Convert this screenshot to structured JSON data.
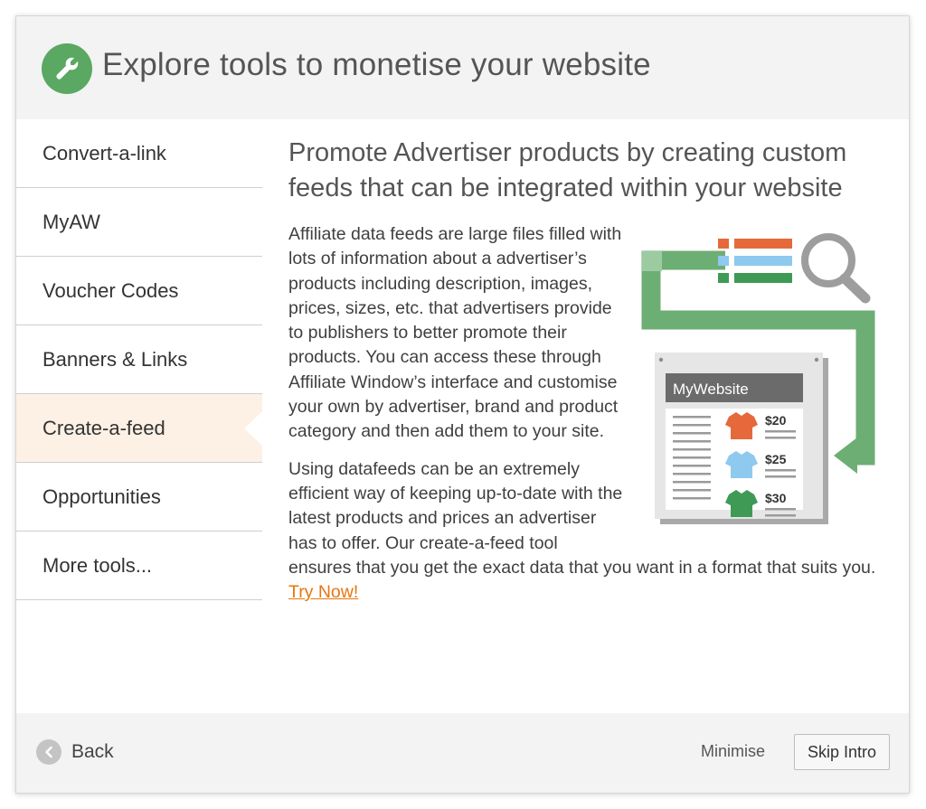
{
  "header": {
    "icon": "wrench-icon",
    "title": "Explore tools to monetise your website"
  },
  "sidebar": {
    "items": [
      {
        "label": "Convert-a-link",
        "active": false
      },
      {
        "label": "MyAW",
        "active": false
      },
      {
        "label": "Voucher Codes",
        "active": false
      },
      {
        "label": "Banners & Links",
        "active": false
      },
      {
        "label": "Create-a-feed",
        "active": true
      },
      {
        "label": "Opportunities",
        "active": false
      },
      {
        "label": "More tools...",
        "active": false
      }
    ]
  },
  "content": {
    "title": "Promote Advertiser products by creating custom feeds that can be integrated within your website",
    "paragraph1": "Affiliate data feeds are large files filled with lots of information about a advertiser’s products including description, images, prices, sizes, etc. that advertisers provide to publishers to better promote their products. You can access these through Affiliate Window’s interface and customise your own by advertiser, brand and product category and then add them to your site.",
    "paragraph2": "Using datafeeds can be an extremely efficient way of keeping up-to-date with the latest products and prices an advertiser has to offer. Our create-a-feed tool ensures that you get the exact data that you want in a format that suits you.",
    "link_label": "Try Now!",
    "illustration": {
      "site_name": "MyWebsite",
      "prices": [
        "$20",
        "$25",
        "$30"
      ]
    }
  },
  "footer": {
    "back_label": "Back",
    "minimise_label": "Minimise",
    "skip_label": "Skip Intro"
  },
  "colors": {
    "accent_green": "#5aa862",
    "active_item_bg": "#fdf0e4",
    "link_orange": "#e8750e",
    "shirt_orange": "#e5693a",
    "shirt_blue": "#8ec9ee",
    "shirt_green": "#3f9a56"
  }
}
